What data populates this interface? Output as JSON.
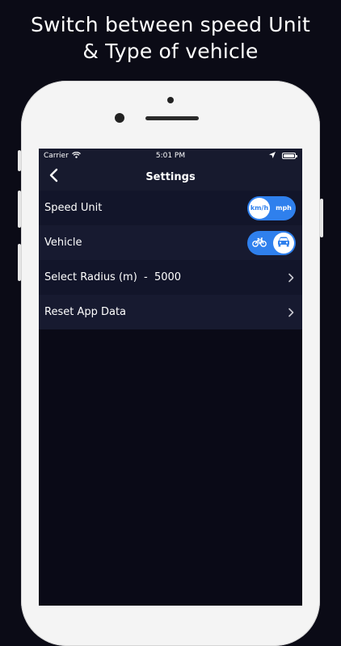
{
  "headline": {
    "line1": "Switch between speed Unit",
    "line2": "& Type of vehicle"
  },
  "status_bar": {
    "carrier": "Carrier",
    "time": "5:01 PM",
    "icons": [
      "wifi-icon",
      "location-arrow-icon",
      "battery-icon"
    ]
  },
  "nav": {
    "title": "Settings",
    "back_icon": "chevron-left-icon"
  },
  "settings": {
    "speed_unit": {
      "label": "Speed Unit",
      "options": [
        "km/h",
        "mph"
      ],
      "selected": "km/h"
    },
    "vehicle": {
      "label": "Vehicle",
      "options": [
        "bicycle-icon",
        "car-icon"
      ],
      "selected": "car-icon"
    },
    "radius": {
      "label": "Select Radius (m)  -  5000"
    },
    "reset": {
      "label": "Reset App Data"
    }
  },
  "colors": {
    "accent": "#2f80ed",
    "background": "#0a0a17",
    "nav_background": "#171a2e"
  }
}
